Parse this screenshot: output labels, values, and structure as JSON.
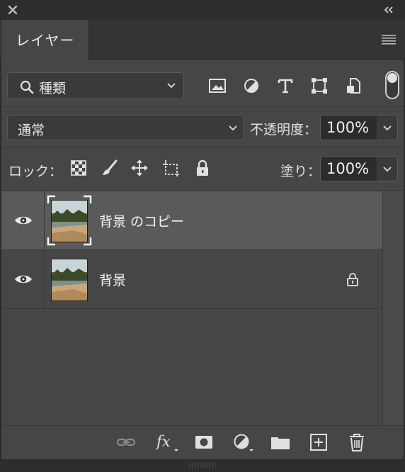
{
  "titlebar": {
    "close_icon": "close-icon",
    "collapse_icon": "double-chevron-left-icon"
  },
  "tabs": [
    {
      "label": "レイヤー",
      "active": true
    }
  ],
  "filter": {
    "selected": "種類",
    "icons": [
      "image-filter-icon",
      "adjustment-filter-icon",
      "type-filter-icon",
      "shape-filter-icon",
      "smart-object-filter-icon"
    ]
  },
  "blend": {
    "mode": "通常",
    "opacity_label": "不透明度：",
    "opacity_value": "100%"
  },
  "lock": {
    "label": "ロック：",
    "fill_label": "塗り：",
    "fill_value": "100%"
  },
  "layers": [
    {
      "name": "背景 のコピー",
      "visible": true,
      "selected": true,
      "locked": false
    },
    {
      "name": "背景",
      "visible": true,
      "selected": false,
      "locked": true
    }
  ],
  "footer": {
    "icons": [
      "link-layers-icon",
      "fx-icon",
      "mask-icon",
      "adjustment-layer-icon",
      "folder-icon",
      "new-layer-icon",
      "trash-icon"
    ]
  },
  "colors": {
    "panel": "#464646",
    "selected_row": "#5a5a5a",
    "header": "#333333"
  }
}
